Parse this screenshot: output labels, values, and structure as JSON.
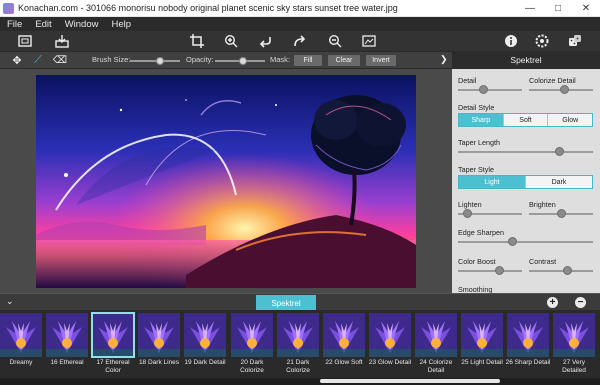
{
  "window": {
    "title": "Konachan.com - 301066 monorisu nobody original planet scenic sky stars sunset tree water.jpg",
    "minimize": "—",
    "maximize": "□",
    "close": "✕"
  },
  "menu": [
    "File",
    "Edit",
    "Window",
    "Help"
  ],
  "toolbar_icons": [
    "fit-screen-icon",
    "import-icon",
    "crop-icon",
    "zoom-in-icon",
    "undo-icon",
    "redo-icon",
    "zoom-out-icon",
    "fullscreen-icon",
    "info-icon",
    "settings-icon",
    "dice-icon"
  ],
  "toolbar2": {
    "brush_size_label": "Brush Size:",
    "opacity_label": "Opacity:",
    "mask_label": "Mask:",
    "fill": "Fill",
    "clear": "Clear",
    "invert": "Invert",
    "brush_size": 0.6,
    "opacity": 0.55
  },
  "panel": {
    "title": "Spektrel",
    "detail": "Detail",
    "colorize_detail": "Colorize Detail",
    "detail_style": "Detail Style",
    "detail_style_options": [
      "Sharp",
      "Soft",
      "Glow"
    ],
    "detail_style_selected": "Sharp",
    "taper_length": "Taper Length",
    "taper_style": "Taper Style",
    "taper_style_options": [
      "Light",
      "Dark"
    ],
    "taper_style_selected": "Light",
    "lighten": "Lighten",
    "brighten": "Brighten",
    "edge_sharpen": "Edge Sharpen",
    "color_boost": "Color Boost",
    "contrast": "Contrast",
    "smoothing": "Smoothing",
    "values": {
      "detail": 0.4,
      "colorize_detail": 0.55,
      "taper_length": 0.75,
      "lighten": 0.15,
      "brighten": 0.5,
      "edge_sharpen": 0.4,
      "color_boost": 0.65,
      "contrast": 0.6
    }
  },
  "strip": {
    "active_tab": "Spektrel",
    "add": "+",
    "remove": "−"
  },
  "presets": [
    {
      "label": "Dreamy"
    },
    {
      "label": "16 Ethereal"
    },
    {
      "label": "17 Ethereal Color",
      "selected": true
    },
    {
      "label": "18 Dark Lines"
    },
    {
      "label": "19 Dark Detail"
    },
    {
      "label": "20 Dark Colorize"
    },
    {
      "label": "21 Dark Colorize"
    },
    {
      "label": "22 Glow Soft"
    },
    {
      "label": "23 Glow Detail"
    },
    {
      "label": "24 Colorize Detail"
    },
    {
      "label": "25 Light Detail"
    },
    {
      "label": "26 Sharp Detail"
    },
    {
      "label": "27 Very Detailed"
    }
  ]
}
